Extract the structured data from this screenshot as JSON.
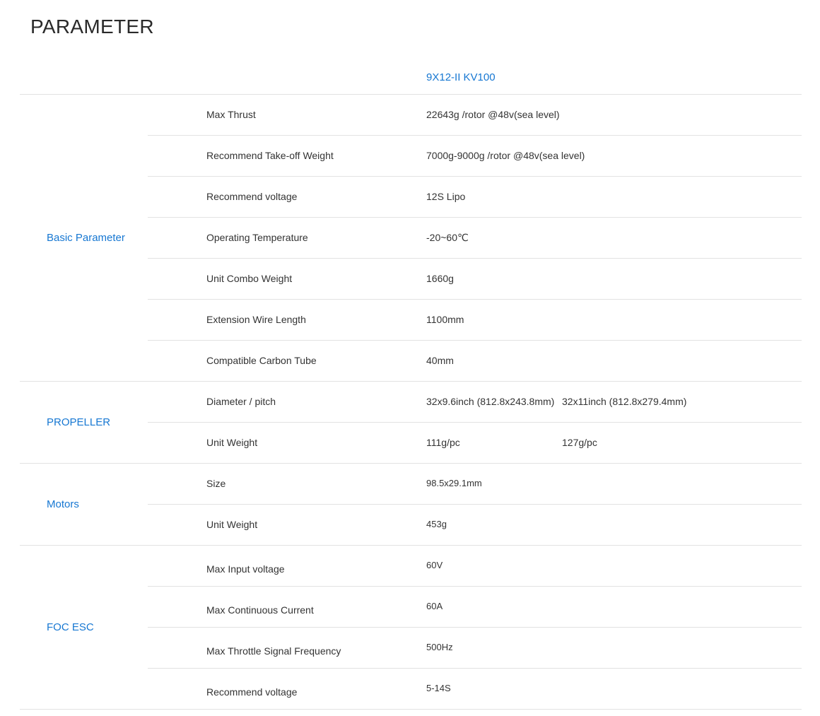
{
  "page": {
    "title": "PARAMETER"
  },
  "table": {
    "model": "9X12-II KV100",
    "sections": [
      {
        "label": "Basic Parameter",
        "rows": [
          {
            "name": "Max Thrust",
            "value": "22643g /rotor @48v(sea level)"
          },
          {
            "name": "Recommend Take-off Weight",
            "value": "7000g-9000g /rotor @48v(sea level)"
          },
          {
            "name": "Recommend voltage",
            "value": "12S Lipo"
          },
          {
            "name": "Operating Temperature",
            "value": "-20~60℃"
          },
          {
            "name": "Unit Combo Weight",
            "value": "1660g"
          },
          {
            "name": "Extension Wire Length",
            "value": "1100mm"
          },
          {
            "name": "Compatible Carbon Tube",
            "value": "40mm"
          }
        ]
      },
      {
        "label": "PROPELLER",
        "rows": [
          {
            "name": "Diameter / pitch",
            "value": "32x9.6inch (812.8x243.8mm)",
            "value2": "32x11inch (812.8x279.4mm)"
          },
          {
            "name": "Unit Weight",
            "value": "111g/pc",
            "value2": "127g/pc"
          }
        ]
      },
      {
        "label": "Motors",
        "rows": [
          {
            "name": "Size",
            "value": "98.5x29.1mm"
          },
          {
            "name": "Unit Weight",
            "value": "453g"
          }
        ]
      },
      {
        "label": "FOC ESC",
        "rows": [
          {
            "name": "Max Input voltage",
            "value": "60V"
          },
          {
            "name": "Max Continuous Current",
            "value": "60A"
          },
          {
            "name": "Max Throttle Signal Frequency",
            "value": "500Hz"
          },
          {
            "name": "Recommend voltage",
            "value": "5-14S"
          }
        ]
      }
    ]
  }
}
